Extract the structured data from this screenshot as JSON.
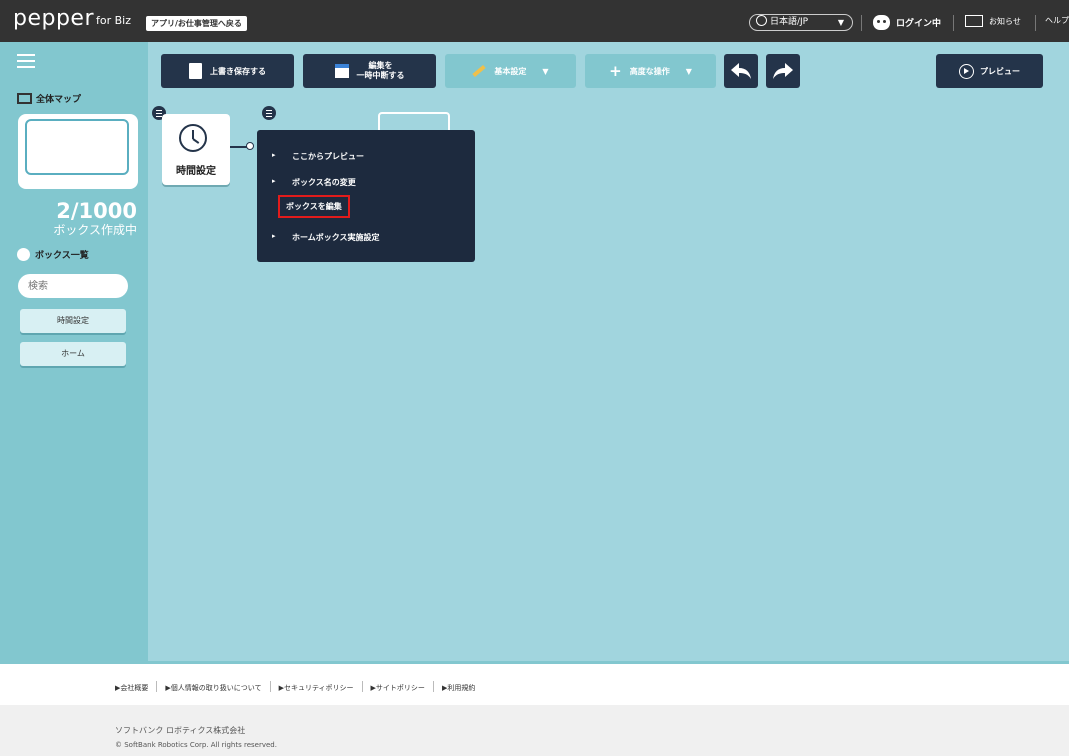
{
  "header": {
    "logo": "pepper",
    "logo_sub": "for Biz",
    "back_label": "アプリ/お仕事管理へ戻る",
    "language": "日本語/JP",
    "login_status": "ログイン中",
    "notice": "お知らせ",
    "help": "ヘルプ"
  },
  "sidebar": {
    "map_title": "全体マップ",
    "box_count": "2/1000",
    "box_count_label": "ボックス作成中",
    "box_list_title": "ボックス一覧",
    "search_placeholder": "検索",
    "items": [
      {
        "label": "時間設定"
      },
      {
        "label": "ホーム"
      }
    ]
  },
  "toolbar": {
    "overwrite_save": "上書き保存する",
    "suspend_line1": "編集を",
    "suspend_line2": "一時中断する",
    "basic_settings": "基本設定",
    "advanced_ops": "高度な操作",
    "preview": "プレビュー"
  },
  "canvas": {
    "boxes": [
      {
        "label": "時間設定"
      }
    ],
    "context_menu": [
      {
        "label": "ここからプレビュー"
      },
      {
        "label": "ボックス名の変更"
      },
      {
        "label": "ボックスを編集",
        "highlighted": true
      },
      {
        "label": "ホームボックス実施設定"
      }
    ]
  },
  "footer": {
    "links": [
      "▶会社概要",
      "▶個人情報の取り扱いについて",
      "▶セキュリティポリシー",
      "▶サイトポリシー",
      "▶利用規約"
    ],
    "company": "ソフトバンク ロボティクス株式会社",
    "copyright": "© SoftBank Robotics Corp. All rights reserved."
  },
  "colors": {
    "topbar": "#333333",
    "sidebar": "#82c7cf",
    "canvas": "#a1d5de",
    "toolbar_button": "#24344a",
    "highlight": "#e21b1b"
  }
}
